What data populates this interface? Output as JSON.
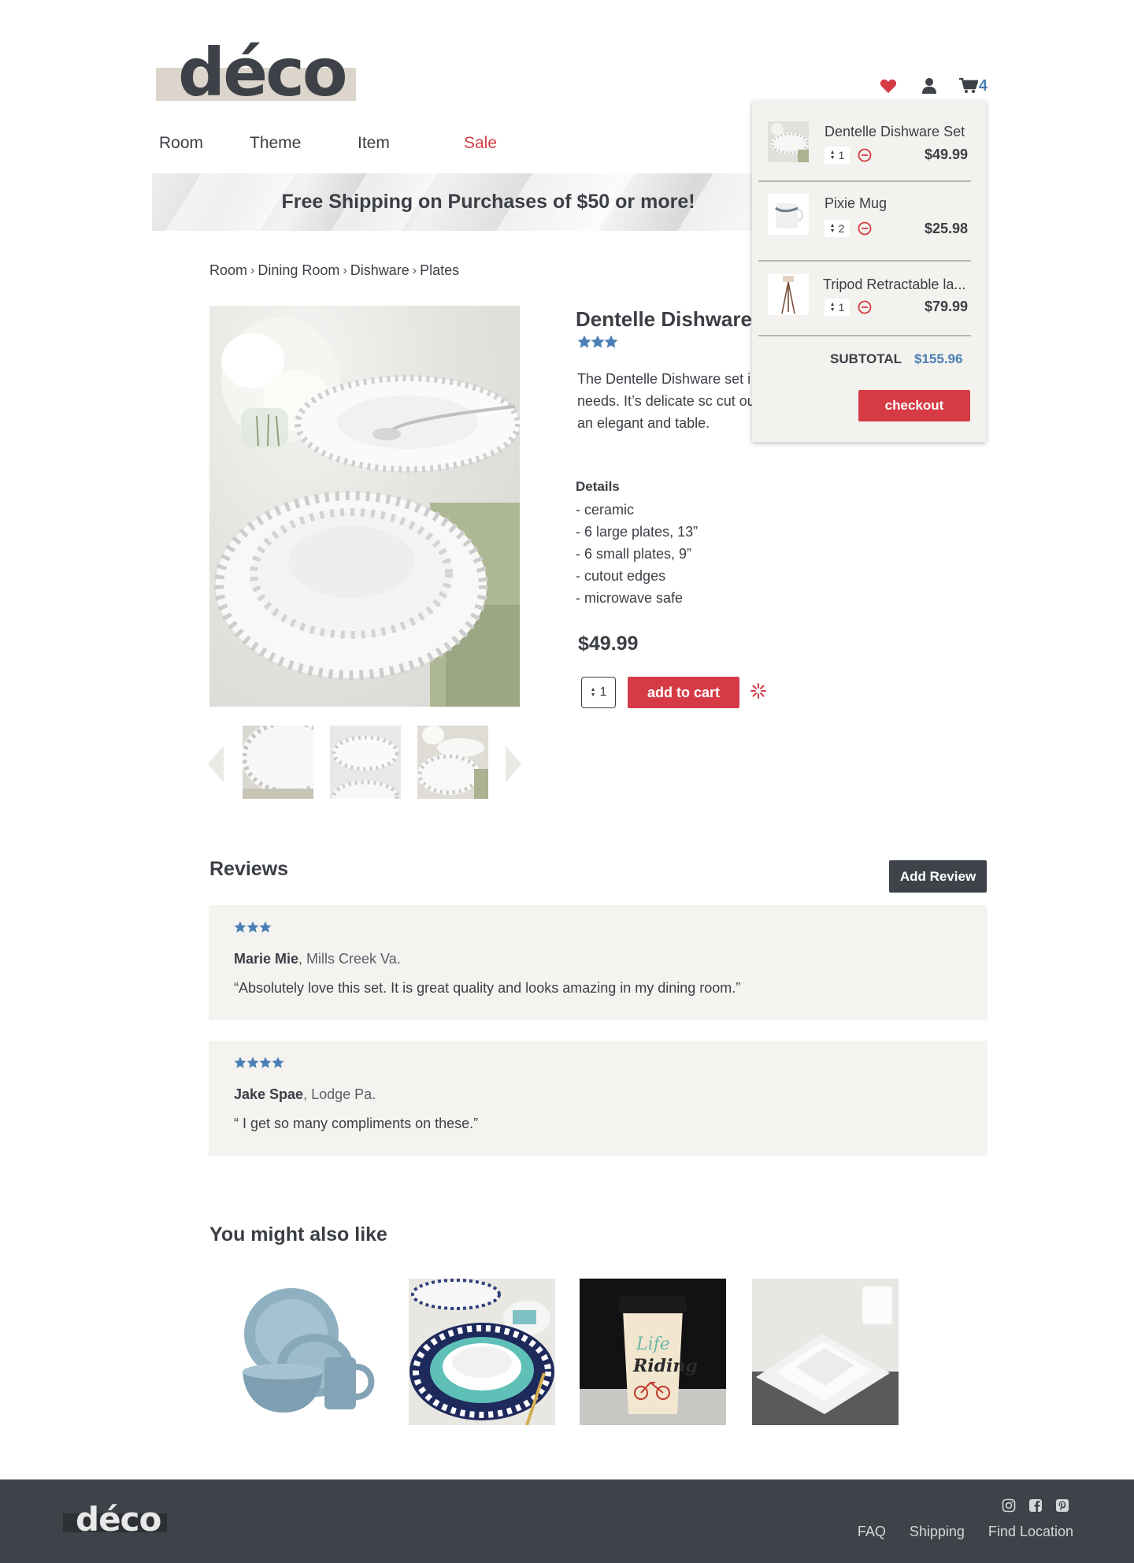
{
  "brand": {
    "logo_text": "déco"
  },
  "header": {
    "cart_count": "4",
    "icons": [
      "heart-icon",
      "user-icon",
      "cart-icon"
    ],
    "accent_color": "#d63b45",
    "link_color": "#4a7fb5"
  },
  "nav": {
    "items": [
      "Room",
      "Theme",
      "Item",
      "Sale"
    ]
  },
  "banner": {
    "text": "Free Shipping on Purchases of $50 or more!"
  },
  "breadcrumb": [
    "Room",
    "Dining Room",
    "Dishware",
    "Plates"
  ],
  "product": {
    "title": "Dentelle Dishware S",
    "rating": 3.5,
    "description": "The Dentelle Dishware set i dining needs. It’s delicate sc cut outs add an elegant and table.",
    "details_heading": "Details",
    "details": [
      "- ceramic",
      "- 6 large plates, 13”",
      "- 6 small plates, 9”",
      "- cutout edges",
      "- microwave safe"
    ],
    "price": "$49.99",
    "quantity": "1",
    "add_to_cart": "add to cart"
  },
  "cart": {
    "items": [
      {
        "name": "Dentelle Dishware Set",
        "qty": "1",
        "price": "$49.99"
      },
      {
        "name": "Pixie Mug",
        "qty": "2",
        "price": "$25.98"
      },
      {
        "name": "Tripod Retractable la...",
        "qty": "1",
        "price": "$79.99"
      }
    ],
    "subtotal_label": "SUBTOTAL",
    "subtotal_value": "$155.96",
    "checkout_label": "checkout"
  },
  "reviews": {
    "heading": "Reviews",
    "add_label": "Add Review",
    "items": [
      {
        "stars": 3,
        "name": "Marie Mie",
        "location": ", Mills Creek Va.",
        "quote": "“Absolutely love this set. It is great quality and looks amazing in my dining room.”"
      },
      {
        "stars": 4,
        "name": "Jake Spae",
        "location": ", Lodge Pa.",
        "quote": "“ I get so many compliments on these.”"
      }
    ]
  },
  "recommendations": {
    "heading": "You might also like"
  },
  "footer": {
    "logo_text": "déco",
    "social": [
      "instagram-icon",
      "facebook-icon",
      "pinterest-icon"
    ],
    "links": [
      "FAQ",
      "Shipping",
      "Find Location"
    ]
  }
}
